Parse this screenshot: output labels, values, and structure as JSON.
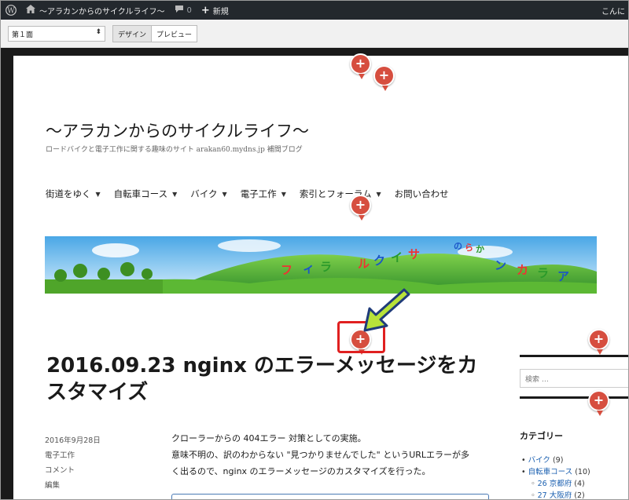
{
  "admin_bar": {
    "site_name": "～アラカンからのサイクルライフ～",
    "comment_count": "0",
    "new_label": "新規",
    "greeting": "こんに"
  },
  "toolbar": {
    "page_select": "第１面",
    "design_label": "デザイン",
    "preview_label": "プレビュー"
  },
  "site": {
    "title": "～アラカンからのサイクルライフ～",
    "description": "ロードバイクと電子工作に関する趣味のサイト arakan60.mydns.jp 補間ブログ"
  },
  "nav": {
    "items": [
      "街道をゆく",
      "自転車コース",
      "バイク",
      "電子工作",
      "索引とフォーラム",
      "お問い合わせ"
    ]
  },
  "header_image": {
    "letters": [
      "フ",
      "ィ",
      "ラ",
      "ル",
      "ク",
      "イ",
      "サ",
      "の",
      "ら",
      "か",
      "ン",
      "カ",
      "ラ",
      "ア"
    ]
  },
  "post": {
    "title": "2016.09.23 nginx のエラーメッセージをカスタマイズ",
    "date": "2016年9月28日",
    "category": "電子工作",
    "comments": "コメント",
    "edit": "編集",
    "paragraph_lines": [
      "クローラーからの 404エラー 対策としての実施。",
      "意味不明の、訳のわからない \"見つかりませんでした\" というURLエラーが多",
      "く出るので、nginx のエラーメッセージのカスタマイズを行った。"
    ]
  },
  "sidebar": {
    "search_placeholder": "検索 …",
    "categories_heading": "カテゴリー",
    "categories": [
      {
        "name": "バイク",
        "count": "(9)"
      },
      {
        "name": "自転車コース",
        "count": "(10)"
      },
      {
        "name": "26 京都府",
        "count": "(4)"
      },
      {
        "name": "27 大阪府",
        "count": "(2)"
      }
    ]
  },
  "colors": {
    "admin_bar": "#23282d",
    "shortcut": "#d64e3f",
    "highlight": "#e02020",
    "arrow": "#b7e23a"
  }
}
